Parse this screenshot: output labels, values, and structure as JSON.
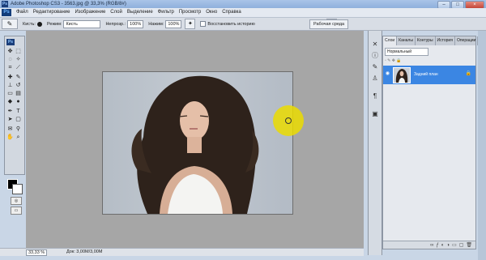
{
  "window": {
    "title": "Adobe Photoshop CS3 - 3563.jpg @ 33,3% (RGB/8#)"
  },
  "menu": {
    "logo": "Ps",
    "items": [
      "Файл",
      "Редактирование",
      "Изображение",
      "Слой",
      "Выделение",
      "Фильтр",
      "Просмотр",
      "Окно",
      "Справка"
    ]
  },
  "options": {
    "brush_label": "Кисть:",
    "mode_label": "Режим:",
    "mode_value": "Кисть",
    "opacity_label": "Непрозр.:",
    "opacity_value": "100%",
    "flow_label": "Нажим:",
    "flow_value": "100%",
    "history_label": "Восстановить историю",
    "workspace_label": "Рабочая среда"
  },
  "tools": {
    "badge": "Ps"
  },
  "status": {
    "zoom": "33,33 %",
    "doc": "Док: 3,00М/3,00М"
  },
  "layers_panel": {
    "tabs": [
      "Слои",
      "Каналы",
      "Контуры",
      "История",
      "Операции"
    ],
    "blend_mode": "Нормальный",
    "layer_name": "Задний план"
  },
  "colors": {
    "accent": "#3b86e3",
    "brush_cursor": "#ebdc00"
  }
}
